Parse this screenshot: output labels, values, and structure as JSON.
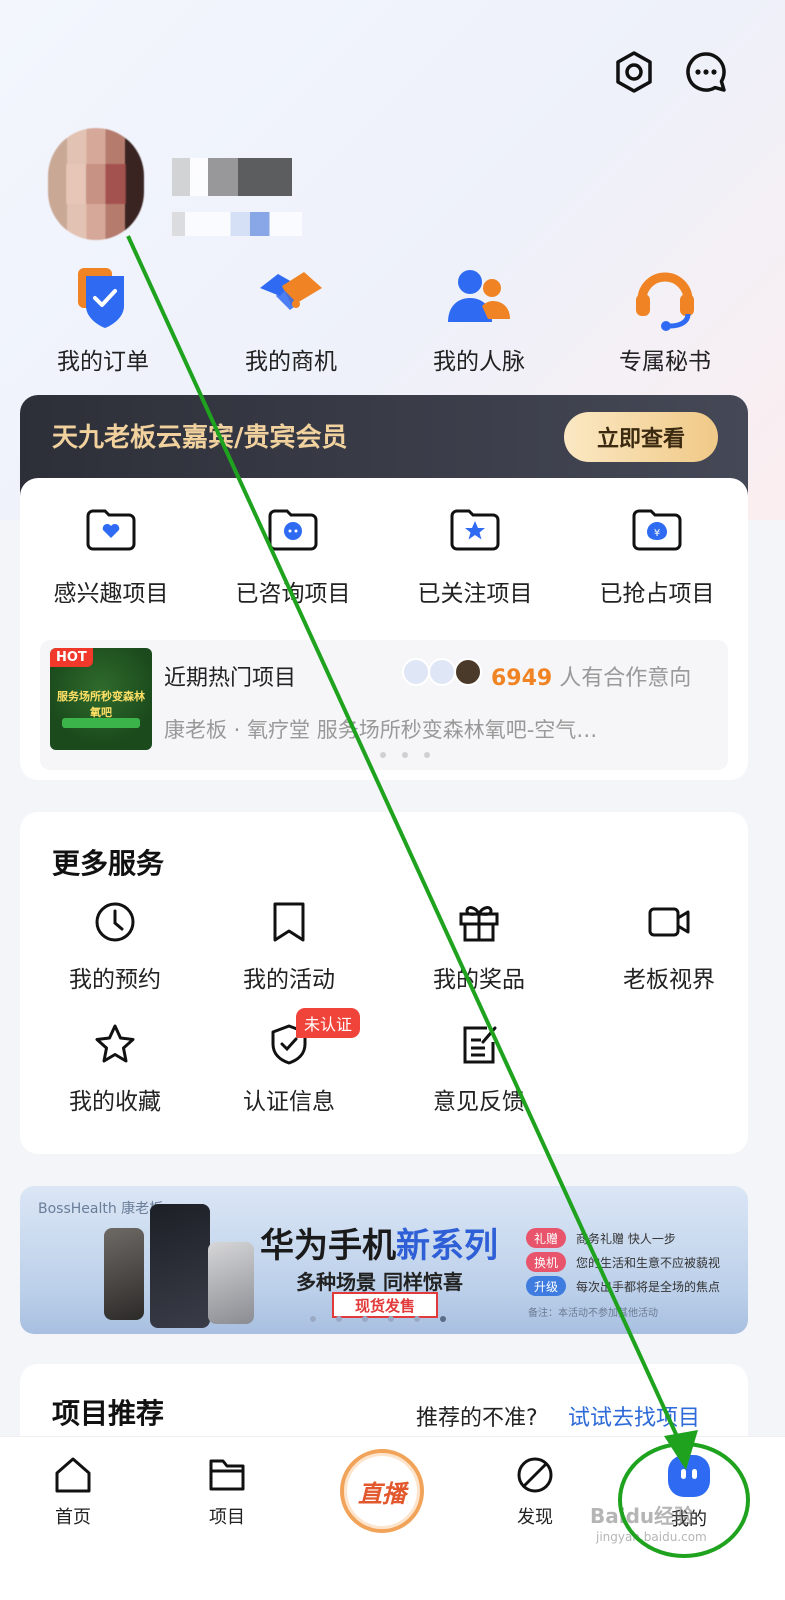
{
  "quick_entries": [
    {
      "label": "我的订单",
      "icon": "order-shield-icon"
    },
    {
      "label": "我的商机",
      "icon": "handshake-icon"
    },
    {
      "label": "我的人脉",
      "icon": "contacts-icon"
    },
    {
      "label": "专属秘书",
      "icon": "headset-icon"
    }
  ],
  "vip": {
    "title": "天九老板云嘉宾/贵宾会员",
    "button": "立即查看"
  },
  "project_status": [
    {
      "label": "感兴趣项目",
      "icon": "folder-heart-icon"
    },
    {
      "label": "已咨询项目",
      "icon": "folder-chat-icon"
    },
    {
      "label": "已关注项目",
      "icon": "folder-star-icon"
    },
    {
      "label": "已抢占项目",
      "icon": "folder-money-icon"
    }
  ],
  "hot": {
    "tag": "HOT",
    "title": "近期热门项目",
    "count": "6949",
    "count_suffix": "人有合作意向",
    "desc": "康老板 · 氧疗堂 服务场所秒变森林氧吧-空气…",
    "thumb_text": "服务场所秒变森林氧吧"
  },
  "more_services": {
    "title": "更多服务",
    "items": [
      {
        "label": "我的预约",
        "icon": "clock-icon"
      },
      {
        "label": "我的活动",
        "icon": "bookmark-icon"
      },
      {
        "label": "我的奖品",
        "icon": "gift-icon"
      },
      {
        "label": "老板视界",
        "icon": "video-camera-icon"
      },
      {
        "label": "我的收藏",
        "icon": "star-icon"
      },
      {
        "label": "认证信息",
        "icon": "shield-check-icon"
      },
      {
        "label": "意见反馈",
        "icon": "feedback-edit-icon"
      }
    ],
    "unverified_badge": "未认证"
  },
  "banner": {
    "logo": "BossHealth 康老板",
    "headline_a": "华为手机",
    "headline_b": "新系列",
    "subline": "多种场景 同样惊喜",
    "cta": "现货发售",
    "pills": [
      {
        "tag": "礼赠",
        "text": "商务礼赠 快人一步",
        "color": "#e8546b"
      },
      {
        "tag": "换机",
        "text": "您的生活和生意不应被藐视",
        "color": "#e8546b"
      },
      {
        "tag": "升级",
        "text": "每次出手都将是全场的焦点",
        "color": "#3f7ce0"
      }
    ],
    "note": "备注：本活动不参加其他活动"
  },
  "recommend": {
    "title": "项目推荐",
    "question": "推荐的不准?",
    "link": "试试去找项目"
  },
  "nav": [
    {
      "label": "首页",
      "icon": "home-icon"
    },
    {
      "label": "项目",
      "icon": "folder-icon"
    },
    {
      "label": "直播",
      "icon": "live-icon"
    },
    {
      "label": "发现",
      "icon": "compass-icon"
    },
    {
      "label": "我的",
      "icon": "mine-icon"
    }
  ],
  "watermark": {
    "brand": "Baidu经验",
    "url": "jingyan.baidu.com"
  }
}
